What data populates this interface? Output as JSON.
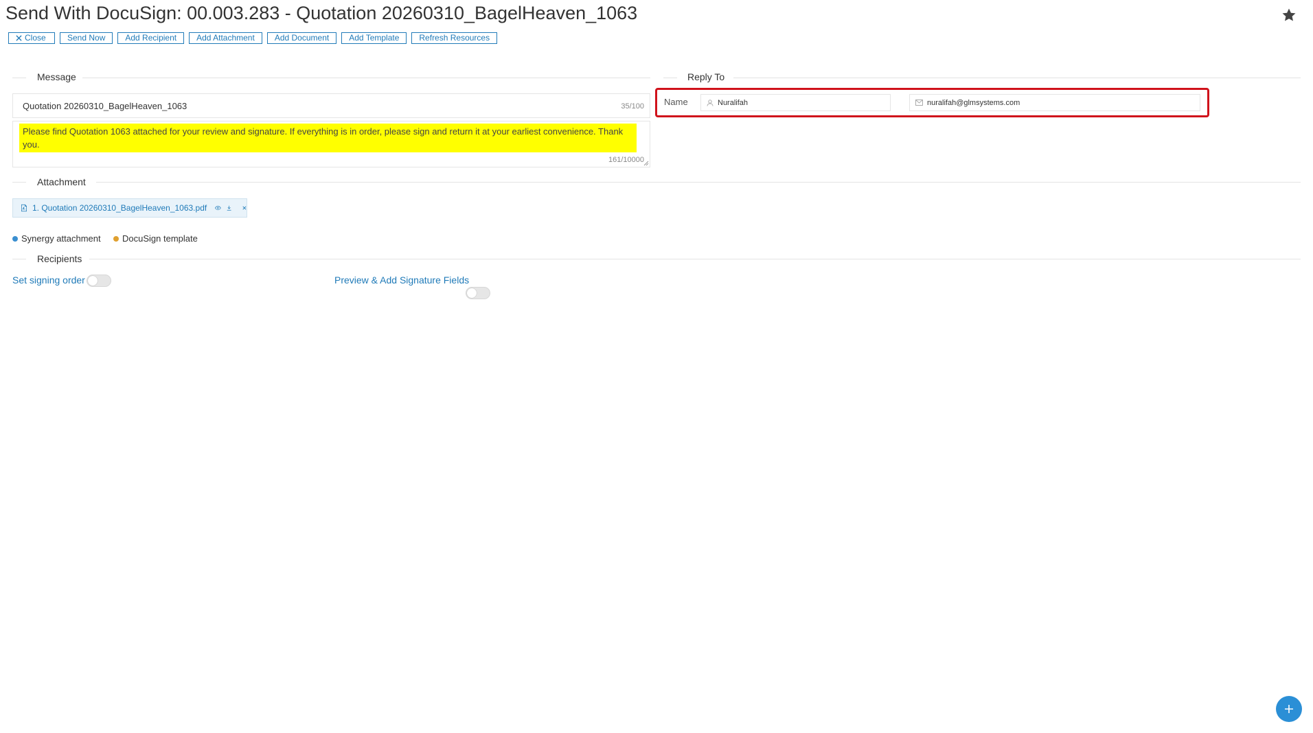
{
  "page": {
    "title": "Send With DocuSign: 00.003.283 - Quotation 20260310_BagelHeaven_1063"
  },
  "toolbar": {
    "close_label": "Close",
    "send_now_label": "Send Now",
    "add_recipient_label": "Add Recipient",
    "add_attachment_label": "Add Attachment",
    "add_document_label": "Add Document",
    "add_template_label": "Add Template",
    "refresh_resources_label": "Refresh Resources"
  },
  "message": {
    "section_label": "Message",
    "subject_value": "Quotation 20260310_BagelHeaven_1063",
    "subject_counter": "35/100",
    "body_value": "Please find Quotation 1063 attached for your review and signature. If everything is in order, please sign and return it at your earliest convenience. Thank you.",
    "body_counter": "161/10000"
  },
  "reply_to": {
    "section_label": "Reply To",
    "name_label": "Name",
    "name_value": "Nuralifah",
    "email_value": "nuralifah@glmsystems.com"
  },
  "attachment": {
    "section_label": "Attachment",
    "items": [
      {
        "label": "1. Quotation 20260310_BagelHeaven_1063.pdf"
      }
    ]
  },
  "legend": {
    "synergy_label": "Synergy attachment",
    "synergy_color": "#3a8fd0",
    "docusign_label": "DocuSign template",
    "docusign_color": "#e0a030"
  },
  "recipients": {
    "section_label": "Recipients",
    "signing_order_label": "Set signing order",
    "signing_order_on": false,
    "preview_label": "Preview & Add Signature Fields",
    "preview_on": false
  },
  "colors": {
    "accent": "#1f7ab8",
    "highlight": "#ffff00",
    "focus_border": "#d0121b",
    "fab": "#2b8fd6"
  },
  "icons": {
    "star": "star-icon",
    "close": "close-icon",
    "user": "user-icon",
    "mail": "mail-icon",
    "pdf": "pdf-file-icon",
    "preview": "eye-icon",
    "download": "download-icon",
    "remove": "remove-icon",
    "add": "plus-icon"
  }
}
